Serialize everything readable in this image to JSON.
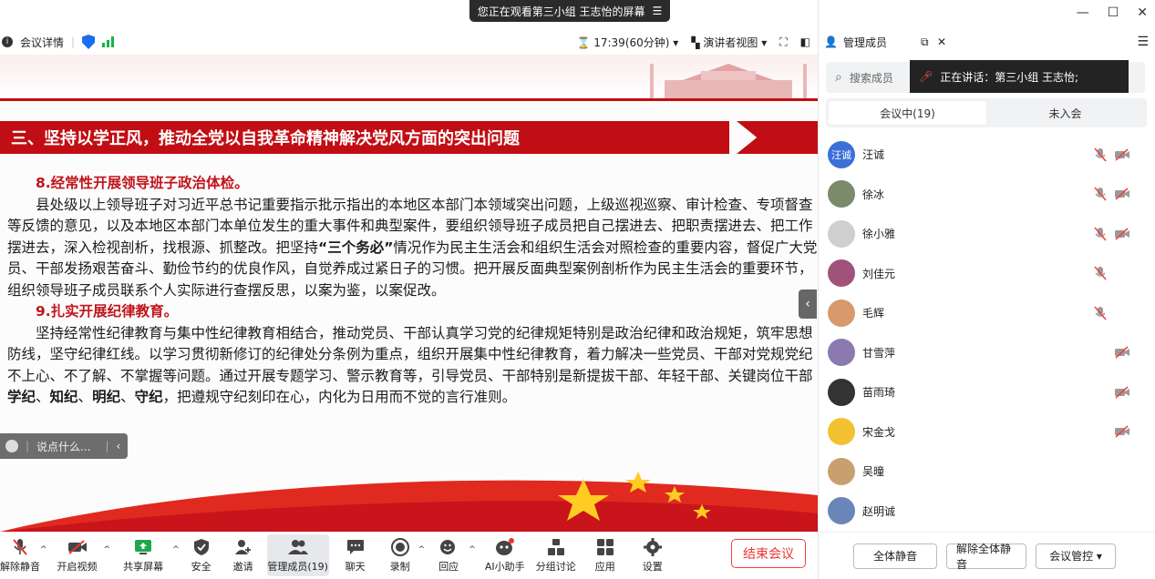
{
  "banner": {
    "text": "您正在观看第三小组 王志怡的屏幕",
    "icon": "menu-icon"
  },
  "topbar": {
    "meeting_details": "会议详情",
    "timer": "17:39(60分钟)",
    "view_mode": "演讲者视图"
  },
  "slide": {
    "title": "三、坚持以学正风，推动全党以自我革命精神解决党风方面的突出问题",
    "head8": "8.经常性开展领导班子政治体检。",
    "para8_a": "县处级以上领导班子对习近平总书记重要指示批示指出的本地区本部门本领域突出问题，上级巡视巡察、审计检查、专项督查等反馈的意见，以及本地区本部门本单位发生的重大事件和典型案件，要组织领导班子成员把自己摆进去、把职责摆进去、把工作摆进去，深入检视剖析，找根源、抓整改。把坚持",
    "para8_bold": "“三个务必”",
    "para8_b": "情况作为民主生活会和组织生活会对照检查的重要内容，督促广大党员、干部发扬艰苦奋斗、勤俭节约的优良作风，自觉养成过紧日子的习惯。把开展反面典型案例剖析作为民主生活会的重要环节，组织领导班子成员联系个人实际进行查摆反思，以案为鉴，以案促改。",
    "head9": "9.扎实开展纪律教育。",
    "para9_a": "坚持经常性纪律教育与集中性纪律教育相结合，推动党员、干部认真学习党的纪律规矩特别是政治纪律和政治规矩，筑牢思想防线，坚守纪律红线。以学习贯彻新修订的纪律处分条例为重点，组织开展集中性纪律教育，着力解决一些党员、干部对党规党纪不上心、不了解、不掌握等问题。通过开展专题学习、警示教育等，引导党员、干部特别是新提拔干部、年轻干部、关键岗位干部",
    "para9_b1": "学纪",
    "para9_b2": "知纪",
    "para9_b3": "明纪",
    "para9_b4": "守纪",
    "para9_sep": "、",
    "para9_c": "，把遵规守纪刻印在心，内化为日用而不觉的言行准则。"
  },
  "chat": {
    "placeholder": "说点什么..."
  },
  "toolbar": {
    "items": [
      {
        "label": "解除静音",
        "icon": "mic-off-icon"
      },
      {
        "label": "开启视频",
        "icon": "camera-off-icon"
      },
      {
        "label": "共享屏幕",
        "icon": "share-screen-icon"
      },
      {
        "label": "安全",
        "icon": "shield-icon"
      },
      {
        "label": "邀请",
        "icon": "invite-icon"
      },
      {
        "label": "管理成员(19)",
        "icon": "members-icon"
      },
      {
        "label": "聊天",
        "icon": "chat-icon"
      },
      {
        "label": "录制",
        "icon": "record-icon"
      },
      {
        "label": "回应",
        "icon": "reaction-icon"
      },
      {
        "label": "AI小助手",
        "icon": "ai-assistant-icon"
      },
      {
        "label": "分组讨论",
        "icon": "breakout-icon"
      },
      {
        "label": "应用",
        "icon": "apps-icon"
      },
      {
        "label": "设置",
        "icon": "settings-icon"
      }
    ],
    "end_meeting": "结束会议"
  },
  "panel": {
    "title": "管理成员",
    "search_placeholder": "搜索成员",
    "speaking": "正在讲话：第三小组 王志怡;",
    "tab_in": "会议中(19)",
    "tab_out": "未入会",
    "members": [
      {
        "name": "汪诚",
        "avatar_text": "汪诚",
        "avatar_color": "#3a6fd8",
        "mic_off": true,
        "cam_off": true
      },
      {
        "name": "徐冰",
        "avatar_text": "",
        "avatar_color": "#7a8a6a",
        "mic_off": true,
        "cam_off": true
      },
      {
        "name": "徐小雅",
        "avatar_text": "",
        "avatar_color": "#cfcfcf",
        "mic_off": true,
        "cam_off": true
      },
      {
        "name": "刘佳元",
        "avatar_text": "",
        "avatar_color": "#a0527a",
        "mic_off": true,
        "cam_off": false
      },
      {
        "name": "毛辉",
        "avatar_text": "",
        "avatar_color": "#d89a6a",
        "mic_off": true,
        "cam_off": false
      },
      {
        "name": "甘雪萍",
        "avatar_text": "",
        "avatar_color": "#8a7ab0",
        "mic_off": false,
        "cam_off": true
      },
      {
        "name": "苗雨琦",
        "avatar_text": "",
        "avatar_color": "#333333",
        "mic_off": false,
        "cam_off": true
      },
      {
        "name": "宋金戈",
        "avatar_text": "",
        "avatar_color": "#f2c230",
        "mic_off": false,
        "cam_off": true
      },
      {
        "name": "吴曈",
        "avatar_text": "",
        "avatar_color": "#c8a070",
        "mic_off": false,
        "cam_off": false
      },
      {
        "name": "赵明诚",
        "avatar_text": "",
        "avatar_color": "#6a86b8",
        "mic_off": false,
        "cam_off": false
      }
    ],
    "mute_all": "全体静音",
    "unmute_all": "解除全体静音",
    "meeting_control": "会议管控"
  }
}
